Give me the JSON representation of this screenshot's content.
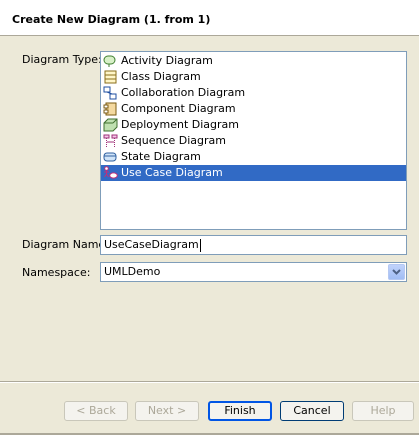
{
  "header": {
    "title": "Create New Diagram (1. from 1)"
  },
  "form": {
    "diagram_type_label": "Diagram Type:",
    "diagram_name_label": "Diagram Name:",
    "namespace_label": "Namespace:",
    "diagram_name_value": "UseCaseDiagram",
    "namespace_value": "UMLDemo"
  },
  "diagram_types": [
    {
      "label": "Activity Diagram",
      "icon": "activity-diagram-icon",
      "selected": false
    },
    {
      "label": "Class Diagram",
      "icon": "class-diagram-icon",
      "selected": false
    },
    {
      "label": "Collaboration Diagram",
      "icon": "collaboration-diagram-icon",
      "selected": false
    },
    {
      "label": "Component Diagram",
      "icon": "component-diagram-icon",
      "selected": false
    },
    {
      "label": "Deployment Diagram",
      "icon": "deployment-diagram-icon",
      "selected": false
    },
    {
      "label": "Sequence Diagram",
      "icon": "sequence-diagram-icon",
      "selected": false
    },
    {
      "label": "State Diagram",
      "icon": "state-diagram-icon",
      "selected": false
    },
    {
      "label": "Use Case Diagram",
      "icon": "use-case-diagram-icon",
      "selected": true
    }
  ],
  "buttons": {
    "back": "< Back",
    "next": "Next >",
    "finish": "Finish",
    "cancel": "Cancel",
    "help": "Help"
  },
  "colors": {
    "selection": "#316ac5",
    "dialog_bg": "#ece9d8",
    "field_border": "#7f9db9"
  }
}
